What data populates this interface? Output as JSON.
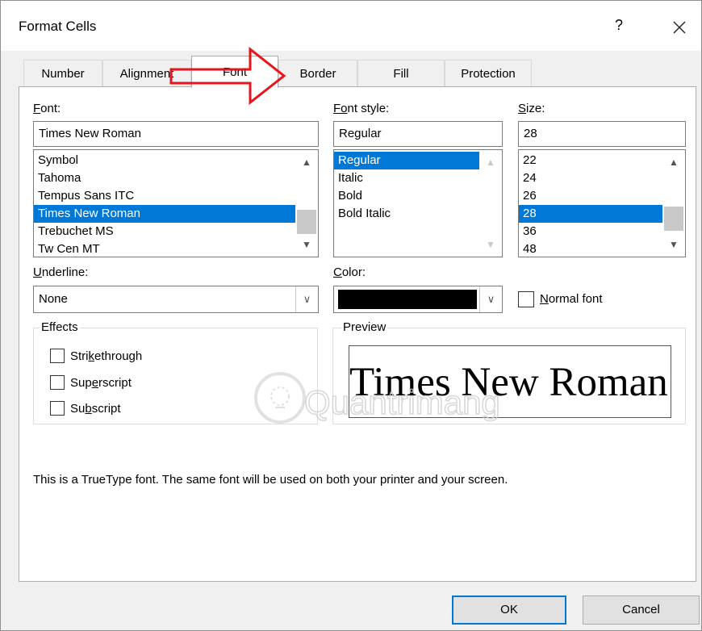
{
  "dialog": {
    "title": "Format Cells",
    "help_label": "?"
  },
  "tabs": [
    {
      "label": "Number",
      "active": false
    },
    {
      "label": "Alignment",
      "active": false
    },
    {
      "label": "Font",
      "active": true
    },
    {
      "label": "Border",
      "active": false
    },
    {
      "label": "Fill",
      "active": false
    },
    {
      "label": "Protection",
      "active": false
    }
  ],
  "font": {
    "label_prefix": "F",
    "label_rest": "ont:",
    "value": "Times New Roman",
    "list": [
      "Symbol",
      "Tahoma",
      "Tempus Sans ITC",
      "Times New Roman",
      "Trebuchet MS",
      "Tw Cen MT"
    ],
    "selected": "Times New Roman"
  },
  "font_style": {
    "label_prefix": "F",
    "label_u": "o",
    "label_rest": "nt style:",
    "value": "Regular",
    "list": [
      "Regular",
      "Italic",
      "Bold",
      "Bold Italic"
    ],
    "selected": "Regular"
  },
  "size": {
    "label_u": "S",
    "label_rest": "ize:",
    "value": "28",
    "list": [
      "22",
      "24",
      "26",
      "28",
      "36",
      "48"
    ],
    "selected": "28"
  },
  "underline": {
    "label_u": "U",
    "label_rest": "nderline:",
    "value": "None"
  },
  "color": {
    "label_u": "C",
    "label_rest": "olor:",
    "swatch": "#000000"
  },
  "normal_font": {
    "label_u": "N",
    "label_rest": "ormal font",
    "checked": false
  },
  "effects": {
    "title": "Effects",
    "strikethrough": {
      "pre": "Stri",
      "u": "k",
      "post": "ethrough",
      "checked": false
    },
    "superscript": {
      "pre": "Sup",
      "u": "e",
      "post": "rscript",
      "checked": false
    },
    "subscript": {
      "pre": "Su",
      "u": "b",
      "post": "script",
      "checked": false
    }
  },
  "preview": {
    "title": "Preview",
    "text": "Times New Roman"
  },
  "info_text": "This is a TrueType font.  The same font will be used on both your printer and your screen.",
  "buttons": {
    "ok": "OK",
    "cancel": "Cancel"
  },
  "watermark_text": "Quantrimang",
  "colors": {
    "accent": "#0078d7",
    "annotation_arrow": "#e8141c"
  }
}
